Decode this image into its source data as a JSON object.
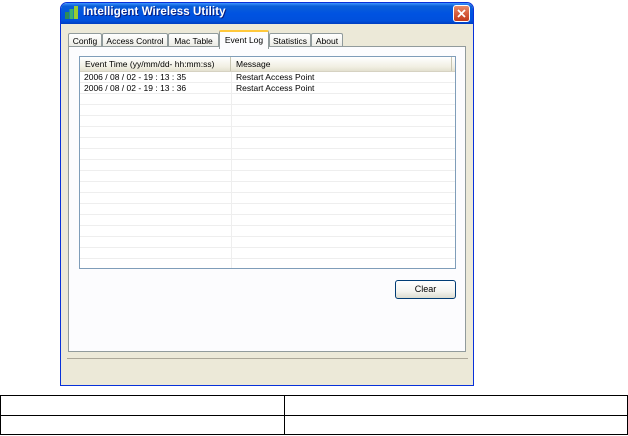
{
  "window": {
    "title": "Intelligent Wireless Utility",
    "titlebar_color": "#0053e1",
    "close_icon": "close-icon"
  },
  "tabs": [
    {
      "label": "Config",
      "active": false
    },
    {
      "label": "Access Control",
      "active": false
    },
    {
      "label": "Mac Table",
      "active": false
    },
    {
      "label": "Event Log",
      "active": true
    },
    {
      "label": "Statistics",
      "active": false
    },
    {
      "label": "About",
      "active": false
    }
  ],
  "event_log": {
    "columns": [
      "Event Time (yy/mm/dd- hh:mm:ss)",
      "Message"
    ],
    "rows": [
      {
        "time": "2006 / 08 / 02 - 19 : 13 : 35",
        "message": "Restart Access Point"
      },
      {
        "time": "2006 / 08 / 02 - 19 : 13 : 36",
        "message": "Restart Access Point"
      }
    ]
  },
  "buttons": {
    "clear_label": "Clear"
  },
  "doc_table": {
    "rows": [
      [
        "",
        ""
      ],
      [
        "",
        ""
      ]
    ]
  }
}
